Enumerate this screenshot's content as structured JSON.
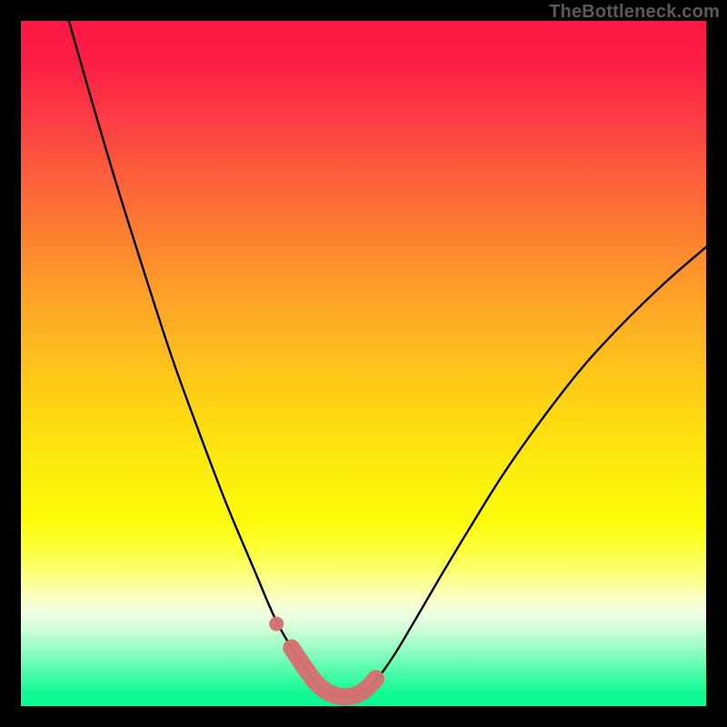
{
  "watermark": "TheBottleneck.com",
  "chart_data": {
    "type": "line",
    "title": "",
    "xlabel": "",
    "ylabel": "",
    "xlim": [
      0,
      1
    ],
    "ylim": [
      0,
      1
    ],
    "grid": false,
    "legend": false,
    "series": [
      {
        "name": "bottleneck-curve",
        "color": "#000000",
        "x": [
          0.07,
          0.1,
          0.14,
          0.18,
          0.22,
          0.26,
          0.3,
          0.34,
          0.37,
          0.395,
          0.415,
          0.43,
          0.445,
          0.46,
          0.478,
          0.5,
          0.52,
          0.545,
          0.575,
          0.61,
          0.655,
          0.705,
          0.76,
          0.82,
          0.88,
          0.94,
          1.0
        ],
        "y": [
          1.0,
          0.895,
          0.76,
          0.633,
          0.51,
          0.4,
          0.295,
          0.2,
          0.13,
          0.085,
          0.055,
          0.035,
          0.022,
          0.015,
          0.014,
          0.022,
          0.04,
          0.075,
          0.125,
          0.185,
          0.26,
          0.34,
          0.418,
          0.495,
          0.56,
          0.618,
          0.67
        ]
      }
    ],
    "highlight": {
      "name": "optimal-zone-marker",
      "color": "#D57172",
      "x": [
        0.395,
        0.415,
        0.43,
        0.445,
        0.462,
        0.48,
        0.5,
        0.518
      ],
      "y": [
        0.085,
        0.055,
        0.035,
        0.022,
        0.015,
        0.014,
        0.022,
        0.04
      ]
    },
    "highlight_point": {
      "name": "marker-start-dot",
      "color": "#D57172",
      "x": 0.373,
      "y": 0.12
    }
  },
  "colors": {
    "curve": "#000000",
    "marker": "#D57172",
    "frame": "#000000"
  }
}
